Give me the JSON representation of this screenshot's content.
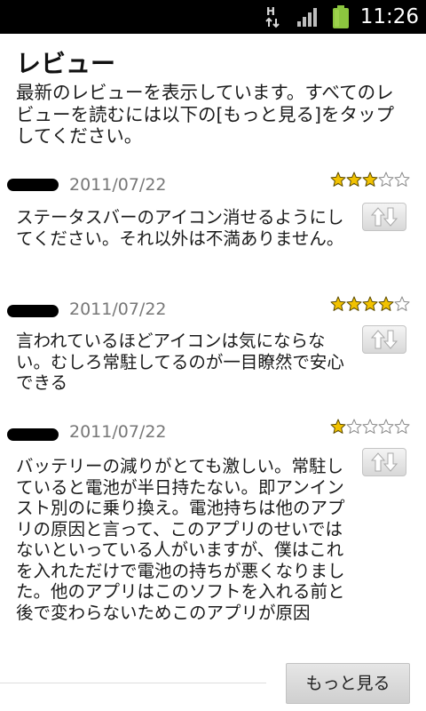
{
  "status_bar": {
    "time": "11:26",
    "network_label": "H",
    "icons": [
      "hspa-data-icon",
      "signal-icon",
      "battery-icon"
    ],
    "battery_color": "#8cc63f"
  },
  "page": {
    "title": "レビュー",
    "intro": "最新のレビューを表示しています。すべてのレビューを読むには以下の[もっと見る]をタップしてください。"
  },
  "reviews": [
    {
      "date": "2011/07/22",
      "rating": 3,
      "max_rating": 5,
      "body": "ステータスバーのアイコン消せるようにしてください。それ以外は不満ありません。"
    },
    {
      "date": "2011/07/22",
      "rating": 4,
      "max_rating": 5,
      "body": "言われているほどアイコンは気にならない。むしろ常駐してるのが一目瞭然で安心できる"
    },
    {
      "date": "2011/07/22",
      "rating": 1,
      "max_rating": 5,
      "body": "バッテリーの減りがとても激しい。常駐していると電池が半日持たない。即アンインスト別のに乗り換え。電池持ちは他のアプリの原因と言って、このアプリのせいではないといっている人がいますが、僕はこれを入れただけで電池の持ちが悪くなりました。他のアプリはこのソフトを入れる前と後で変わらないためこのアプリが原因"
    }
  ],
  "more_button_label": "もっと見る",
  "colors": {
    "star_filled": "#f2c200",
    "star_empty": "#ffffff",
    "star_outline": "#8a8a8a",
    "date_text": "#777777"
  }
}
